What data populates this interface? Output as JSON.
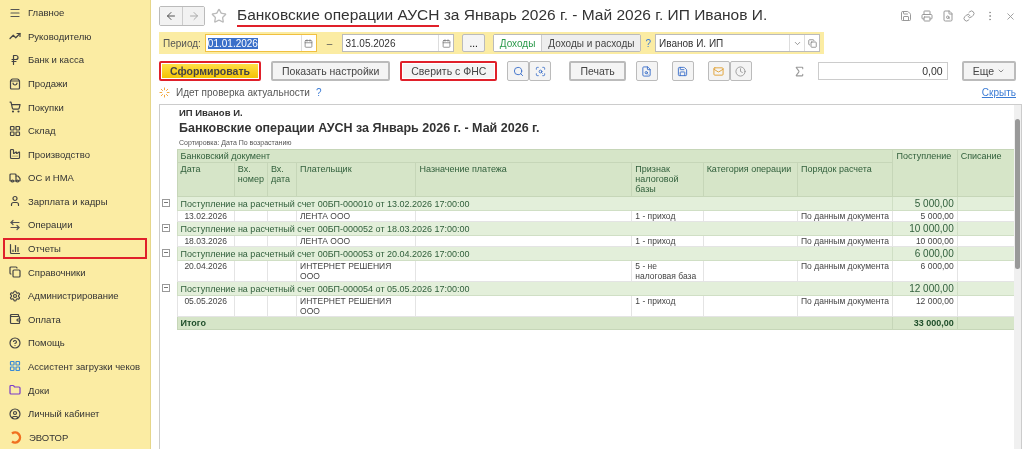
{
  "sidebar": {
    "items": [
      {
        "label": "Главное",
        "highlighted": false
      },
      {
        "label": "Руководителю",
        "highlighted": false
      },
      {
        "label": "Банк и касса",
        "highlighted": false
      },
      {
        "label": "Продажи",
        "highlighted": false
      },
      {
        "label": "Покупки",
        "highlighted": false
      },
      {
        "label": "Склад",
        "highlighted": false
      },
      {
        "label": "Производство",
        "highlighted": false
      },
      {
        "label": "ОС и НМА",
        "highlighted": false
      },
      {
        "label": "Зарплата и кадры",
        "highlighted": false
      },
      {
        "label": "Операции",
        "highlighted": false
      },
      {
        "label": "Отчеты",
        "highlighted": true
      },
      {
        "label": "Справочники",
        "highlighted": false
      },
      {
        "label": "Администрирование",
        "highlighted": false
      },
      {
        "label": "Оплата",
        "highlighted": false
      },
      {
        "label": "Помощь",
        "highlighted": false
      },
      {
        "label": "Ассистент загрузки чеков",
        "highlighted": false
      },
      {
        "label": "Доки",
        "highlighted": false
      },
      {
        "label": "Личный кабинет",
        "highlighted": false
      },
      {
        "label": "ЭВОТОР",
        "highlighted": false
      }
    ]
  },
  "window": {
    "title_parts": [
      {
        "text": "Банковские операции АУСН",
        "underlined": true
      },
      {
        "text": " за Январь 2026 г. - Май 2026 г. ИП Иванов И.",
        "underlined": false
      }
    ]
  },
  "filters": {
    "period_label": "Период:",
    "date_from": "01.01.2026",
    "dash": "–",
    "date_to": "31.05.2026",
    "more": "...",
    "mode_tabs": [
      {
        "label": "Доходы",
        "selected": true
      },
      {
        "label": "Доходы и расходы",
        "selected": false
      }
    ],
    "help": "?",
    "organization": "Иванов И. ИП"
  },
  "toolbar": {
    "buttons": [
      {
        "label": "Сформировать",
        "kind": "primary",
        "highlighted": true
      },
      {
        "label": "Показать настройки",
        "kind": "normal",
        "highlighted": false
      },
      {
        "label": "Сверить с ФНС",
        "kind": "normal",
        "highlighted": true
      }
    ],
    "print": "Печать",
    "sum": "0,00",
    "more": "Еще"
  },
  "status": {
    "text": "Идет проверка актуальности",
    "help": "?",
    "hide": "Скрыть"
  },
  "report": {
    "org": "ИП Иванов И.",
    "title": "Банковские операции АУСН  за Январь 2026 г. - Май 2026 г.",
    "sort": "Сортировка: Дата По возрастанию",
    "group_header": "Банковский документ",
    "columns": [
      "Дата",
      "Вх. номер",
      "Вх. дата",
      "Плательщик",
      "Назначение платежа",
      "Признак налоговой базы",
      "Категория операции",
      "Порядок расчета"
    ],
    "amount_columns": [
      "Поступление",
      "Списание"
    ],
    "groups": [
      {
        "title": "Поступление на расчетный счет 00БП-000010 от 13.02.2026 17:00:00",
        "amount": "5 000,00",
        "expanded": true,
        "rows": [
          {
            "cells": [
              "13.02.2026",
              "",
              "",
              "ЛЕНТА ООО",
              "",
              "1 - приход",
              "",
              "По данным документа"
            ],
            "amount": "5 000,00"
          }
        ]
      },
      {
        "title": "Поступление на расчетный счет 00БП-000052 от 18.03.2026 17:00:00",
        "amount": "10 000,00",
        "expanded": true,
        "rows": [
          {
            "cells": [
              "18.03.2026",
              "",
              "",
              "ЛЕНТА ООО",
              "",
              "1 - приход",
              "",
              "По данным документа"
            ],
            "amount": "10 000,00"
          }
        ]
      },
      {
        "title": "Поступление на расчетный счет 00БП-000053 от 20.04.2026 17:00:00",
        "amount": "6 000,00",
        "expanded": true,
        "rows": [
          {
            "cells": [
              "20.04.2026",
              "",
              "",
              "ИНТЕРНЕТ РЕШЕНИЯ ООО",
              "",
              "5 - не налоговая база",
              "",
              "По данным документа"
            ],
            "amount": "6 000,00"
          }
        ]
      },
      {
        "title": "Поступление на расчетный счет 00БП-000054 от 05.05.2026 17:00:00",
        "amount": "12 000,00",
        "expanded": true,
        "rows": [
          {
            "cells": [
              "05.05.2026",
              "",
              "",
              "ИНТЕРНЕТ РЕШЕНИЯ ООО",
              "",
              "1 - приход",
              "",
              "По данным документа"
            ],
            "amount": "12 000,00"
          }
        ]
      }
    ],
    "total": {
      "label": "Итого",
      "amount": "33 000,00"
    }
  }
}
